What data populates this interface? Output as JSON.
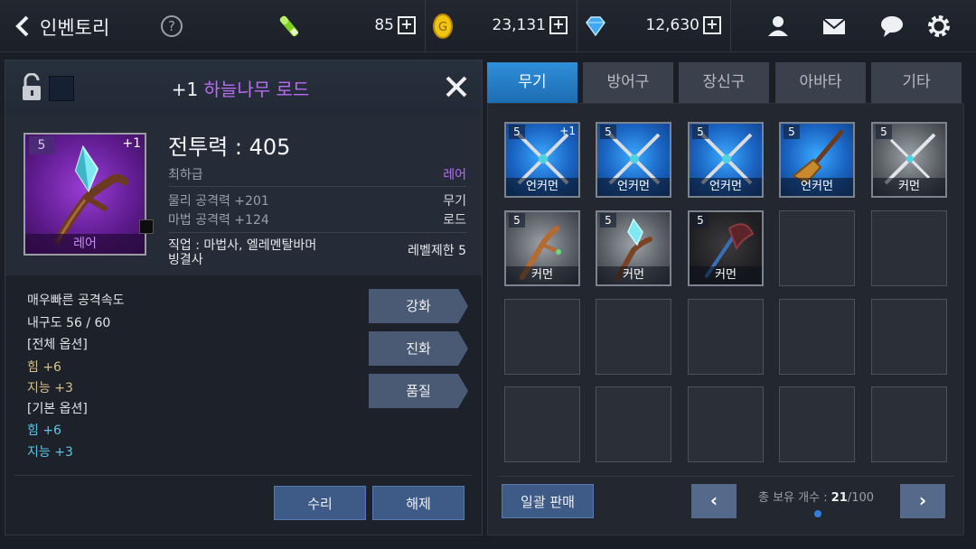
{
  "header": {
    "title": "인벤토리",
    "help": "?",
    "resources": [
      {
        "icon": "stamina-icon",
        "value": "85"
      },
      {
        "icon": "gold-coin-icon",
        "value": "23,131"
      },
      {
        "icon": "diamond-gem-icon",
        "value": "12,630"
      }
    ],
    "plus": "+"
  },
  "item": {
    "plus": "+1",
    "name": "하늘나무 로드",
    "card_level": "5",
    "card_plus": "+1",
    "card_grade": "레어",
    "combat_power": "전투력 : 405",
    "grade_left": "최하급",
    "grade_right": "레어",
    "phys_attack": "물리 공격력 +201",
    "mag_attack": "마법 공격력 +124",
    "type1": "무기",
    "type2": "로드",
    "job_line1": "직업 : 마법사, 엘레멘탈바머",
    "job_line2": "빙결사",
    "level_limit": "레벨제한 5",
    "desc": [
      {
        "text": "매우빠른 공격속도",
        "style": "white"
      },
      {
        "text": "내구도 56 / 60",
        "style": "white"
      },
      {
        "text": "[전체 옵션]",
        "style": "white"
      },
      {
        "text": "힘 +6",
        "style": "yellow"
      },
      {
        "text": "지능 +3",
        "style": "yellow"
      },
      {
        "text": "[기본 옵션]",
        "style": "white"
      },
      {
        "text": "힘 +6",
        "style": "cyan"
      },
      {
        "text": "지능 +3",
        "style": "cyan"
      }
    ],
    "actions": [
      "강화",
      "진화",
      "품질"
    ],
    "repair": "수리",
    "unequip": "해제"
  },
  "tabs": [
    "무기",
    "방어구",
    "장신구",
    "아바타",
    "기타"
  ],
  "slots": [
    {
      "level": "5",
      "plus": "+1",
      "grade": "언커먼",
      "rarity": "uncommon",
      "icon": "crossed-swords-icon"
    },
    {
      "level": "5",
      "plus": "",
      "grade": "언커먼",
      "rarity": "uncommon",
      "icon": "crossed-swords-icon"
    },
    {
      "level": "5",
      "plus": "",
      "grade": "언커먼",
      "rarity": "uncommon",
      "icon": "crossed-swords-icon"
    },
    {
      "level": "5",
      "plus": "",
      "grade": "언커먼",
      "rarity": "uncommon",
      "icon": "broom-staff-icon"
    },
    {
      "level": "5",
      "plus": "",
      "grade": "커먼",
      "rarity": "common",
      "icon": "crossed-swords-icon"
    },
    {
      "level": "5",
      "plus": "",
      "grade": "커먼",
      "rarity": "common",
      "icon": "wooden-wand-icon"
    },
    {
      "level": "5",
      "plus": "",
      "grade": "커먼",
      "rarity": "common",
      "icon": "crystal-rod-icon"
    },
    {
      "level": "5",
      "plus": "",
      "grade": "커먼",
      "rarity": "dark",
      "icon": "axe-icon"
    }
  ],
  "footer": {
    "sell_all": "일괄 판매",
    "count_label": "총 보유 개수 : ",
    "count_current": "21",
    "count_total": "/100",
    "prev": "‹",
    "next": "›"
  }
}
